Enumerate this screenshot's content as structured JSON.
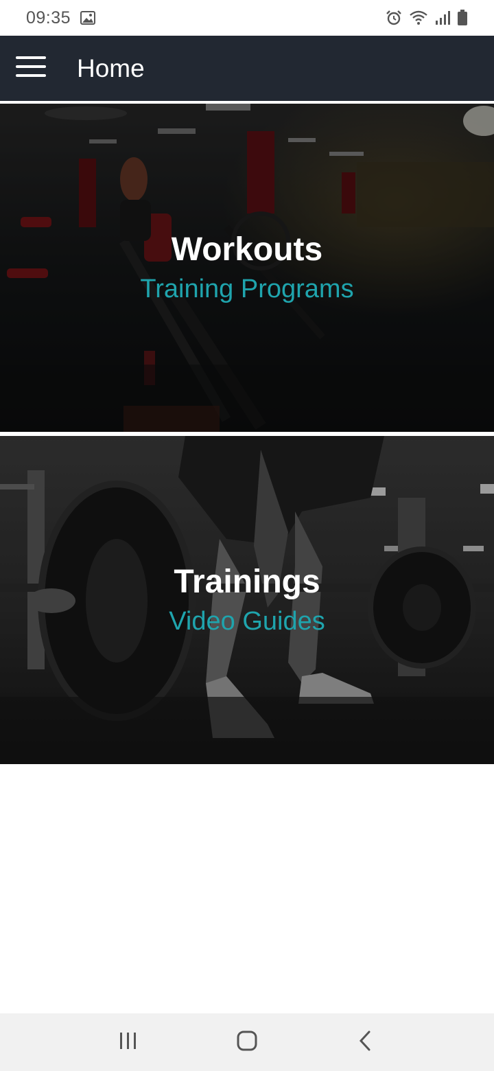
{
  "status_bar": {
    "time": "09:35",
    "icons": [
      "gallery-icon",
      "alarm-icon",
      "wifi-icon",
      "signal-icon",
      "battery-icon"
    ]
  },
  "app_bar": {
    "title": "Home",
    "menu_icon": "hamburger-menu-icon",
    "background": "#222832"
  },
  "cards": [
    {
      "title": "Workouts",
      "subtitle": "Training Programs",
      "image": "gym-interior-photo"
    },
    {
      "title": "Trainings",
      "subtitle": "Video Guides",
      "image": "barbell-deadlift-photo"
    }
  ],
  "colors": {
    "accent": "#1fa4ad",
    "app_bar": "#222832",
    "nav_bar": "#f1f1f1"
  },
  "nav_bar": {
    "buttons": [
      "recent-apps-icon",
      "home-icon",
      "back-icon"
    ]
  }
}
